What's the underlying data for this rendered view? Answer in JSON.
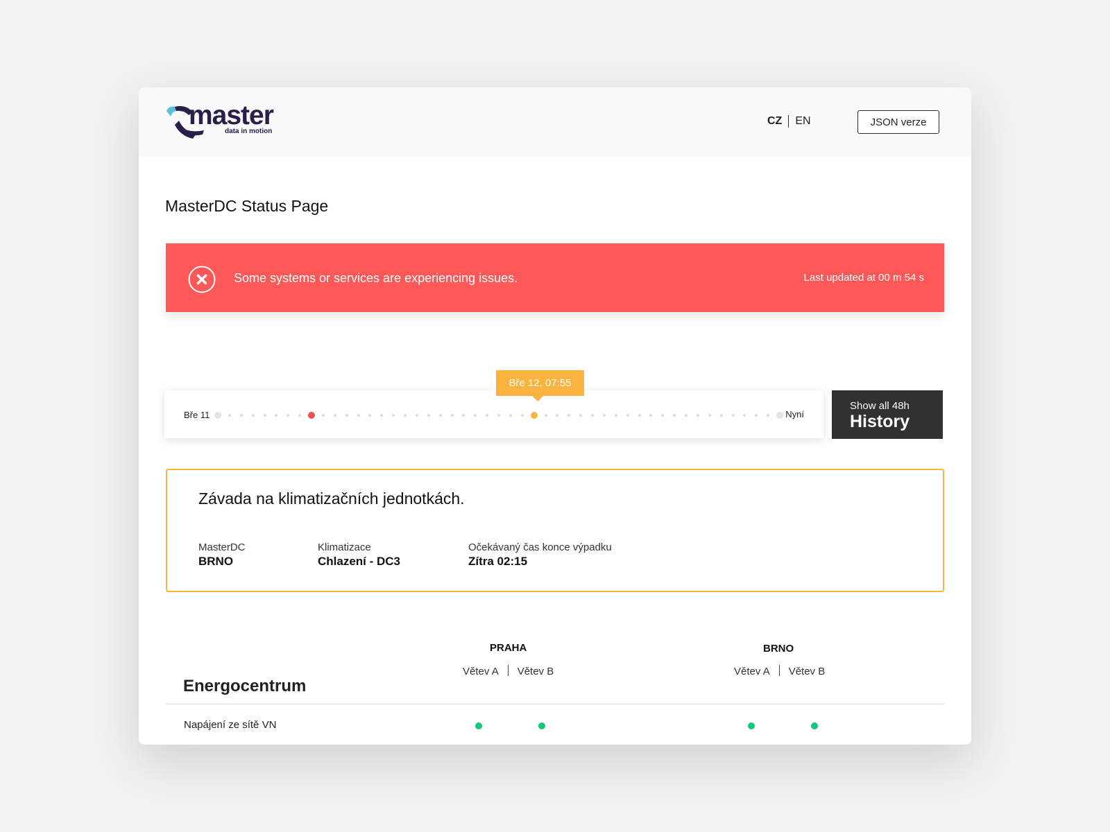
{
  "header": {
    "logo": {
      "word": "master",
      "tagline": "data in motion",
      "icon": "master-swoosh-icon",
      "colors": {
        "dark": "#2a1f4a",
        "accent": "#5bc2d6"
      }
    },
    "languages": [
      {
        "code": "CZ",
        "active": true
      },
      {
        "code": "EN",
        "active": false
      }
    ],
    "json_button": "JSON verze"
  },
  "page_title": "MasterDC Status Page",
  "alert": {
    "icon": "close-circle-icon",
    "message": "Some systems or services are experiencing issues.",
    "updated": "Last updated at 00 m 54 s",
    "color": "#fc5858"
  },
  "timeline": {
    "start_label": "Bře 11",
    "end_label": "Nyní",
    "tooltip": "Bře 12, 07:55",
    "total_slots": 49,
    "events": [
      {
        "slot": 8,
        "status": "outage",
        "color": "#f0504f"
      },
      {
        "slot": 27,
        "status": "issue",
        "color": "#fbb340"
      }
    ],
    "selected_slot": 27
  },
  "history_button": {
    "small": "Show all 48h",
    "big": "History"
  },
  "incident": {
    "title": "Závada na klimatizačních jednotkách.",
    "border_color": "#f8b445",
    "fields": [
      {
        "label": "MasterDC",
        "value": "BRNO"
      },
      {
        "label": "Klimatizace",
        "value": "Chlazení - DC3"
      },
      {
        "label": "Očekávaný čas konce výpadku",
        "value": "Zítra 02:15"
      }
    ]
  },
  "status_grid": {
    "section_title": "Energocentrum",
    "locations": [
      {
        "name": "PRAHA",
        "branches": [
          "Větev A",
          "Větev B"
        ]
      },
      {
        "name": "BRNO",
        "branches": [
          "Větev A",
          "Větev B"
        ]
      }
    ],
    "rows": [
      {
        "label": "Napájení ze sítě VN",
        "statuses": [
          "ok",
          "ok",
          "ok",
          "ok"
        ]
      }
    ],
    "ok_color": "#15c77a"
  }
}
